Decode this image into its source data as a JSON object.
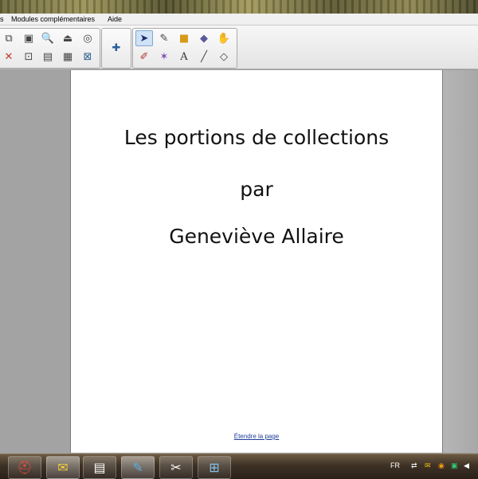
{
  "menu": {
    "items": [
      {
        "label": "s"
      },
      {
        "label": "Modules complémentaires"
      },
      {
        "label": "Aide"
      }
    ]
  },
  "toolbar": {
    "group1": [
      {
        "icon": "copy-page-icon",
        "glyph": "⧉"
      },
      {
        "icon": "screen-capture-icon",
        "glyph": "▣"
      },
      {
        "icon": "magnifier-icon",
        "glyph": "🔍"
      },
      {
        "icon": "recorder-icon",
        "glyph": "⏏"
      },
      {
        "icon": "spotlight-icon",
        "glyph": "◎"
      },
      {
        "icon": "delete-icon",
        "glyph": "✕"
      },
      {
        "icon": "screen-shade-icon",
        "glyph": "⊡"
      },
      {
        "icon": "display-icon",
        "glyph": "▤"
      },
      {
        "icon": "table-icon",
        "glyph": "▦"
      },
      {
        "icon": "close-box-icon",
        "glyph": "⊠"
      }
    ],
    "group2": [
      {
        "icon": "add-on-puzzle-icon",
        "glyph": "✚"
      }
    ],
    "group3": [
      {
        "icon": "select-arrow-icon",
        "glyph": "➤"
      },
      {
        "icon": "pen-icon",
        "glyph": "✎"
      },
      {
        "icon": "shapes-icon",
        "glyph": "■"
      },
      {
        "icon": "eraser-icon",
        "glyph": "◆"
      },
      {
        "icon": "fill-icon",
        "glyph": "✋"
      },
      {
        "icon": "creative-pens-icon",
        "glyph": "✐"
      },
      {
        "icon": "magic-pen-icon",
        "glyph": "✶"
      },
      {
        "icon": "text-icon",
        "glyph": "A"
      },
      {
        "icon": "line-icon",
        "glyph": "╱"
      },
      {
        "icon": "eraser-tool-icon",
        "glyph": "◇"
      }
    ]
  },
  "page": {
    "title": "Les portions de collections",
    "by": "par",
    "author": "Geneviève Allaire",
    "extend_link": "Étendre la page"
  },
  "taskbar": {
    "apps": [
      {
        "icon": "acrobat-icon",
        "glyph": "⛑"
      },
      {
        "icon": "outlook-icon",
        "glyph": "✉"
      },
      {
        "icon": "presentation-icon",
        "glyph": "▤"
      },
      {
        "icon": "smart-notebook-icon",
        "glyph": "✎"
      },
      {
        "icon": "tools-icon",
        "glyph": "✂"
      },
      {
        "icon": "network-app-icon",
        "glyph": "⊞"
      }
    ],
    "language": "FR"
  }
}
